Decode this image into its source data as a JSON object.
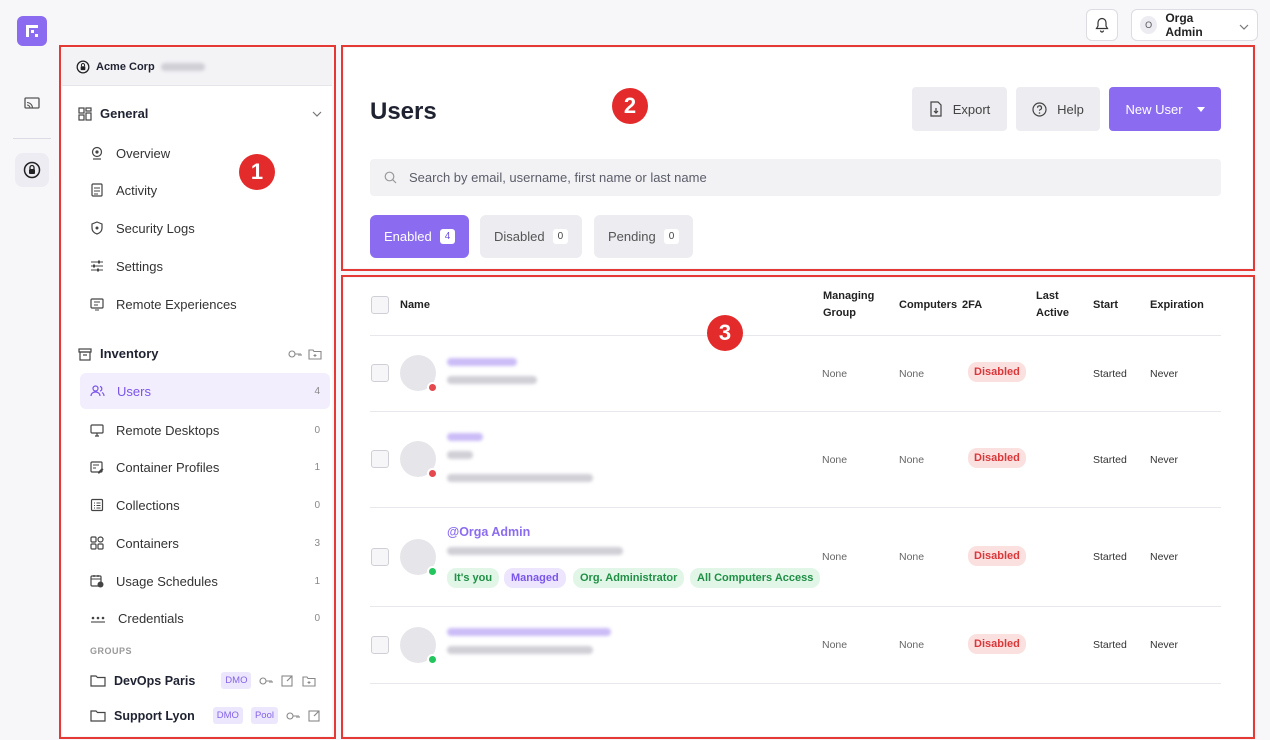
{
  "topbar": {
    "user_initial": "O",
    "user_name": "Orga Admin"
  },
  "annotations": [
    "1",
    "2",
    "3"
  ],
  "sidebar": {
    "org_name": "Acme Corp",
    "general": {
      "label": "General",
      "items": [
        {
          "label": "Overview",
          "icon": "overview-icon"
        },
        {
          "label": "Activity",
          "icon": "activity-icon"
        },
        {
          "label": "Security Logs",
          "icon": "shield-icon"
        },
        {
          "label": "Settings",
          "icon": "sliders-icon"
        },
        {
          "label": "Remote Experiences",
          "icon": "remote-experiences-icon"
        }
      ]
    },
    "inventory": {
      "label": "Inventory",
      "items": [
        {
          "label": "Users",
          "count": "4",
          "active": true
        },
        {
          "label": "Remote Desktops",
          "count": "0"
        },
        {
          "label": "Container Profiles",
          "count": "1"
        },
        {
          "label": "Collections",
          "count": "0"
        },
        {
          "label": "Containers",
          "count": "3"
        },
        {
          "label": "Usage Schedules",
          "count": "1"
        },
        {
          "label": "Credentials",
          "count": "0"
        }
      ]
    },
    "groups_header": "GROUPS",
    "groups": [
      {
        "label": "DevOps Paris",
        "tags": [
          "DMO"
        ]
      },
      {
        "label": "Support Lyon",
        "tags": [
          "DMO",
          "Pool"
        ]
      }
    ]
  },
  "header": {
    "title": "Users",
    "export_label": "Export",
    "help_label": "Help",
    "new_user_label": "New User",
    "search_placeholder": "Search by email, username, first name or last name",
    "tabs": [
      {
        "label": "Enabled",
        "count": "4",
        "active": true
      },
      {
        "label": "Disabled",
        "count": "0"
      },
      {
        "label": "Pending",
        "count": "0"
      }
    ]
  },
  "table": {
    "columns": {
      "name": "Name",
      "managing_group_1": "Managing",
      "managing_group_2": "Group",
      "computers": "Computers",
      "twofa": "2FA",
      "last_active_1": "Last",
      "last_active_2": "Active",
      "start": "Start",
      "expiration": "Expiration"
    },
    "rows": [
      {
        "managing_group": "None",
        "computers": "None",
        "twofa": "Disabled",
        "start": "Started",
        "expiration": "Never",
        "status": "#e5484d"
      },
      {
        "managing_group": "None",
        "computers": "None",
        "twofa": "Disabled",
        "start": "Started",
        "expiration": "Never",
        "status": "#e5484d"
      },
      {
        "username": "@Orga Admin",
        "managing_group": "None",
        "computers": "None",
        "twofa": "Disabled",
        "start": "Started",
        "expiration": "Never",
        "status": "#22c55e",
        "tags": [
          "It's you",
          "Managed",
          "Org. Administrator",
          "All Computers Access"
        ]
      },
      {
        "managing_group": "None",
        "computers": "None",
        "twofa": "Disabled",
        "start": "Started",
        "expiration": "Never",
        "status": "#22c55e"
      }
    ]
  },
  "colors": {
    "accent": "#8b6cf0",
    "annotation": "#e53935",
    "danger": "#d9383a",
    "success": "#22c55e"
  }
}
